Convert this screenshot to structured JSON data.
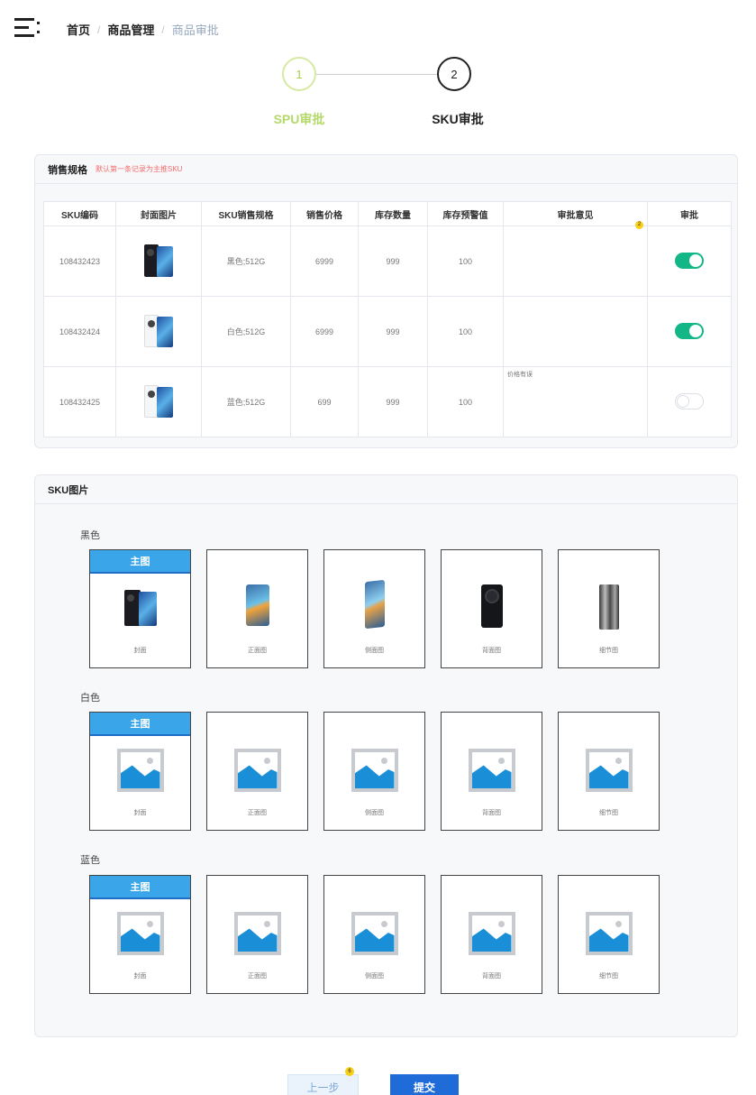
{
  "breadcrumb": [
    "首页",
    "商品管理",
    "商品审批"
  ],
  "steps": [
    {
      "num": "1",
      "title": "SPU审批",
      "status": "done"
    },
    {
      "num": "2",
      "title": "SKU审批",
      "status": "active"
    }
  ],
  "sales_spec": {
    "title": "销售规格",
    "hint": "默认第一条记录为主推SKU",
    "columns": [
      "SKU编码",
      "封面图片",
      "SKU销售规格",
      "销售价格",
      "库存数量",
      "库存预警值",
      "审批意见",
      "审批"
    ],
    "rows": [
      {
        "code": "108432423",
        "thumb": "black-phone",
        "spec": "黑色;512G",
        "price": "6999",
        "stock": "999",
        "warning": "100",
        "opinion": "",
        "approved": true
      },
      {
        "code": "108432424",
        "thumb": "white-phone",
        "spec": "白色;512G",
        "price": "6999",
        "stock": "999",
        "warning": "100",
        "opinion": "",
        "approved": true
      },
      {
        "code": "108432425",
        "thumb": "white-phone",
        "spec": "蓝色;512G",
        "price": "699",
        "stock": "999",
        "warning": "100",
        "opinion": "价格有误",
        "approved": false
      }
    ],
    "badge": "2"
  },
  "sku_images": {
    "title": "SKU图片",
    "main_tag": "主图",
    "groups": [
      {
        "color": "黑色",
        "images": [
          "封面",
          "正面图",
          "侧面图",
          "背面图",
          "细节图"
        ],
        "icons": [
          "phone-cover-icon",
          "phone-front-icon",
          "phone-side-icon",
          "phone-back-icon",
          "phone-detail-icon"
        ]
      },
      {
        "color": "白色",
        "images": [
          "封面",
          "正面图",
          "侧面图",
          "背面图",
          "细节图"
        ],
        "icons": [
          "image-placeholder-icon"
        ]
      },
      {
        "color": "蓝色",
        "images": [
          "封面",
          "正面图",
          "侧面图",
          "背面图",
          "细节图"
        ],
        "icons": [
          "image-placeholder-icon"
        ]
      }
    ]
  },
  "buttons": {
    "prev": "上一步",
    "submit": "提交",
    "prev_badge": "6"
  },
  "colors": {
    "accent": "#13b787",
    "primary": "#1f6cd9",
    "step_done": "#a8cf45",
    "tag": "#3aa5e8"
  }
}
